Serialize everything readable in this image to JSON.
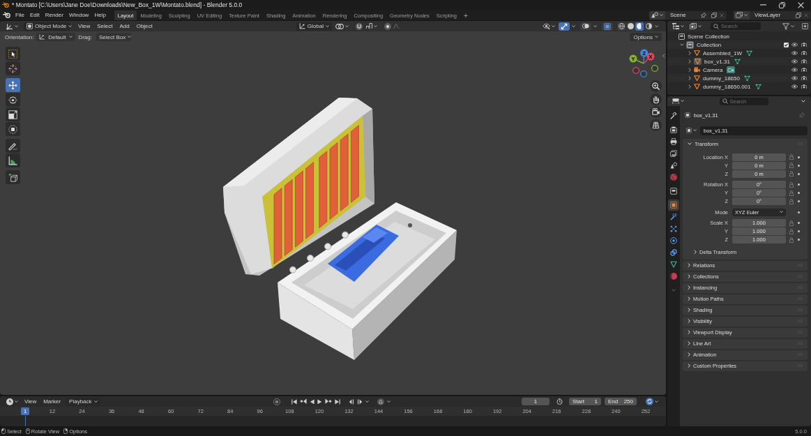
{
  "window": {
    "title": "* Montato [C:\\Users\\Jane Doe\\Downloads\\New_Box_1W\\Montato.blend] - Blender 5.0.0"
  },
  "menu": [
    "File",
    "Edit",
    "Render",
    "Window",
    "Help"
  ],
  "workspaces": [
    {
      "label": "Layout",
      "selected": true
    },
    {
      "label": "Modeling",
      "selected": false
    },
    {
      "label": "Sculpting",
      "selected": false
    },
    {
      "label": "UV Editing",
      "selected": false
    },
    {
      "label": "Texture Paint",
      "selected": false
    },
    {
      "label": "Shading",
      "selected": false
    },
    {
      "label": "Animation",
      "selected": false
    },
    {
      "label": "Rendering",
      "selected": false
    },
    {
      "label": "Compositing",
      "selected": false
    },
    {
      "label": "Geometry Nodes",
      "selected": false
    },
    {
      "label": "Scripting",
      "selected": false
    }
  ],
  "add_workspace": "+",
  "scene": {
    "value": "Scene"
  },
  "view_layer": {
    "value": "ViewLayer"
  },
  "viewport": {
    "mode": "Object Mode",
    "menus": [
      "View",
      "Select",
      "Add",
      "Object"
    ],
    "orientation": "Global",
    "toggles": [
      {
        "kind": "gizmo",
        "on": true
      },
      {
        "kind": "overlay",
        "on": false
      },
      {
        "kind": "xray",
        "on": false
      }
    ],
    "shading": [
      {
        "kind": "wireframe",
        "selected": false
      },
      {
        "kind": "solid",
        "selected": false
      },
      {
        "kind": "material",
        "selected": true
      },
      {
        "kind": "rendered",
        "selected": false
      }
    ],
    "tool_settings": {
      "orientation_label": "Orientation:",
      "orientation": "Default",
      "drag_label": "Drag:",
      "drag": "Select Box",
      "options": "Options"
    },
    "tool_groups": [
      {
        "tools": [
          {
            "kind": "select",
            "selected": false
          },
          {
            "kind": "cursor",
            "selected": false
          }
        ]
      },
      {
        "tools": [
          {
            "kind": "move",
            "selected": true
          },
          {
            "kind": "rotate",
            "selected": false
          },
          {
            "kind": "scale",
            "selected": false
          },
          {
            "kind": "transform",
            "selected": false
          }
        ]
      },
      {
        "tools": [
          {
            "kind": "annotate",
            "selected": false
          },
          {
            "kind": "measure",
            "selected": false
          }
        ]
      },
      {
        "tools": [
          {
            "kind": "add_cube",
            "selected": false
          }
        ]
      }
    ],
    "axes": [
      {
        "label": "X",
        "color": "#e0455a"
      },
      {
        "label": "Y",
        "color": "#84b52e"
      },
      {
        "label": "Z",
        "color": "#3d8be8"
      }
    ]
  },
  "timeline": {
    "menus": [
      {
        "label": "View",
        "kind": "menu"
      },
      {
        "label": "Marker",
        "kind": "menu"
      },
      {
        "label": "Playback",
        "kind": "dropdown"
      }
    ],
    "current_frame": "1",
    "start_label": "Start",
    "start": "1",
    "end_label": "End",
    "end": "250",
    "playhead": "1",
    "ticks": [
      "12",
      "24",
      "36",
      "48",
      "60",
      "72",
      "84",
      "96",
      "108",
      "120",
      "132",
      "144",
      "156",
      "168",
      "180",
      "192",
      "204",
      "216",
      "228",
      "240",
      "252"
    ]
  },
  "status_bar": {
    "hints": [
      {
        "kind": "left",
        "label": "Select"
      },
      {
        "kind": "middle",
        "label": "Rotate View"
      },
      {
        "kind": "right",
        "label": "Options"
      }
    ],
    "version": "5.0.0"
  },
  "outliner": {
    "search_placeholder": "Search",
    "root": {
      "name": "Scene Collection",
      "kind": "collection",
      "children": [
        {
          "name": "Collection",
          "kind": "collection",
          "expanded": true,
          "active": true,
          "checked": true,
          "children": [
            {
              "name": "Assembled_1W",
              "kind": "mesh",
              "expanded": false,
              "active": false
            },
            {
              "name": "box_v1.31",
              "kind": "mesh",
              "expanded": false,
              "active": true
            },
            {
              "name": "Camera",
              "kind": "camera",
              "expanded": false,
              "active": false
            },
            {
              "name": "dummy_18650",
              "kind": "mesh",
              "expanded": false,
              "active": false
            },
            {
              "name": "dummy_18650.001",
              "kind": "mesh",
              "expanded": false,
              "active": false
            }
          ]
        }
      ]
    }
  },
  "properties": {
    "search_placeholder": "Search",
    "tab_groups": [
      {
        "tabs": [
          {
            "kind": "tool",
            "selected": false
          }
        ]
      },
      {
        "tabs": [
          {
            "kind": "render",
            "selected": false
          },
          {
            "kind": "output",
            "selected": false
          },
          {
            "kind": "view_layer",
            "selected": false
          },
          {
            "kind": "scene",
            "selected": false
          },
          {
            "kind": "world",
            "selected": false
          }
        ]
      },
      {
        "tabs": [
          {
            "kind": "collection",
            "selected": false
          }
        ]
      },
      {
        "tabs": [
          {
            "kind": "object",
            "selected": true
          },
          {
            "kind": "modifiers",
            "selected": false
          },
          {
            "kind": "particles",
            "selected": false
          },
          {
            "kind": "physics",
            "selected": false
          },
          {
            "kind": "constraints",
            "selected": false
          },
          {
            "kind": "data",
            "selected": false
          },
          {
            "kind": "material",
            "selected": false
          }
        ]
      }
    ],
    "object_name": "box_v1.31",
    "datablock": "box_v1.31",
    "transform": {
      "title": "Transform",
      "expanded": true,
      "groups": [
        {
          "rows": [
            {
              "label": "Location X",
              "kind": "number",
              "value": "0 m",
              "locked": false
            },
            {
              "label": "Y",
              "kind": "number",
              "value": "0 m",
              "locked": false
            },
            {
              "label": "Z",
              "kind": "number",
              "value": "0 m",
              "locked": false
            }
          ]
        },
        {
          "rows": [
            {
              "label": "Rotation X",
              "kind": "number",
              "value": "0°",
              "locked": false
            },
            {
              "label": "Y",
              "kind": "number",
              "value": "0°",
              "locked": false
            },
            {
              "label": "Z",
              "kind": "number",
              "value": "0°",
              "locked": false
            }
          ]
        },
        {
          "rows": [
            {
              "label": "Mode",
              "kind": "dropdown",
              "value": "XYZ Euler"
            }
          ]
        },
        {
          "rows": [
            {
              "label": "Scale X",
              "kind": "number",
              "value": "1.000",
              "locked": false
            },
            {
              "label": "Y",
              "kind": "number",
              "value": "1.000",
              "locked": false
            },
            {
              "label": "Z",
              "kind": "number",
              "value": "1.000",
              "locked": false
            }
          ]
        }
      ],
      "subpanels": [
        {
          "title": "Delta Transform",
          "expanded": false
        }
      ]
    },
    "panels": [
      {
        "title": "Relations",
        "expanded": false
      },
      {
        "title": "Collections",
        "expanded": false
      },
      {
        "title": "Instancing",
        "expanded": false
      },
      {
        "title": "Motion Paths",
        "expanded": false
      },
      {
        "title": "Shading",
        "expanded": false
      },
      {
        "title": "Visibility",
        "expanded": false
      },
      {
        "title": "Viewport Display",
        "expanded": false
      },
      {
        "title": "Line Art",
        "expanded": false
      },
      {
        "title": "Animation",
        "expanded": false
      },
      {
        "title": "Custom Properties",
        "expanded": false
      }
    ]
  }
}
